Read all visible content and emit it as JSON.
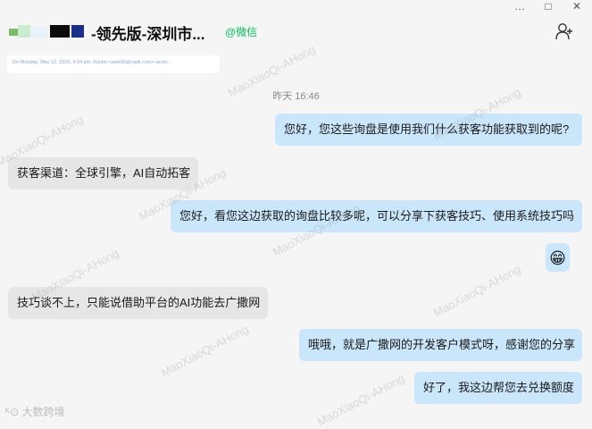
{
  "window": {
    "title": "-领先版-深圳市...",
    "wechat_tag": "@微信",
    "controls": [
      "…",
      "□",
      "✕"
    ]
  },
  "quoted_email": {
    "line": "On Monday, May 12, 2025, 4:34 pm, Kristin <sale06@ruijik.com> wrote:"
  },
  "timestamp": "昨天 16:46",
  "messages": [
    {
      "side": "me",
      "text": "您好，您这些询盘是使用我们什么获客功能获取到的呢?"
    },
    {
      "side": "them",
      "text": "获客渠道：全球引擎，AI自动拓客"
    },
    {
      "side": "me",
      "text": "您好，看您这边获取的询盘比较多呢，可以分享下获客技巧、使用系统技巧吗"
    },
    {
      "side": "me",
      "text": "😁",
      "icon": "grinning-emoji-icon"
    },
    {
      "side": "them",
      "text": "技巧谈不上，只能说借助平台的AI功能去广撒网"
    },
    {
      "side": "me",
      "text": "哦哦，就是广撒网的开发客户模式呀，感谢您的分享"
    },
    {
      "side": "me",
      "text": "好了，我这边帮您去兑换额度"
    }
  ],
  "watermark": "MaoXiaoQi-AHong",
  "corner_brand": "大数跨境",
  "colors": {
    "my_bubble": "#c9e6fb",
    "their_bubble": "#e6e6e6",
    "wechat_green": "#07c160",
    "background": "#f5f5f5"
  }
}
